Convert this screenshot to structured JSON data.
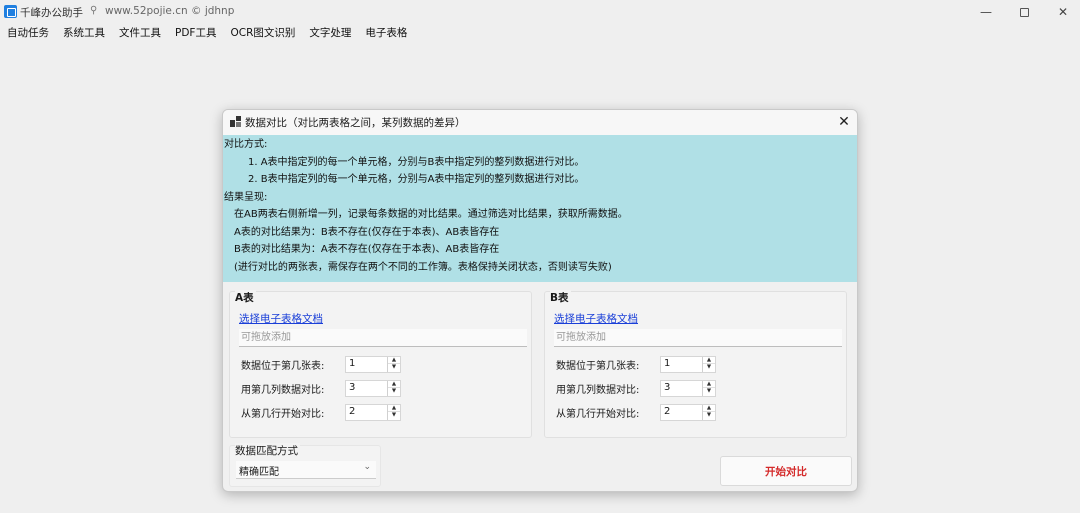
{
  "app": {
    "title": "千峰办公助手",
    "subtitle": "www.52pojie.cn © jdhnp",
    "window_controls": {
      "minimize": "—",
      "close": "✕"
    }
  },
  "menu": [
    "自动任务",
    "系统工具",
    "文件工具",
    "PDF工具",
    "OCR图文识别",
    "文字处理",
    "电子表格"
  ],
  "dialog": {
    "title": "数据对比（对比两表格之间，某列数据的差异）",
    "close": "✕",
    "info_lines": [
      "对比方式:",
      "1. A表中指定列的每一个单元格，分别与B表中指定列的整列数据进行对比。",
      "2. B表中指定列的每一个单元格，分别与A表中指定列的整列数据进行对比。",
      "结果呈现:",
      "在AB两表右侧新增一列，记录每条数据的对比结果。通过筛选对比结果，获取所需数据。",
      "A表的对比结果为：B表不存在(仅存在于本表)、AB表皆存在",
      "B表的对比结果为：A表不存在(仅存在于本表)、AB表皆存在",
      "(进行对比的两张表，需保存在两个不同的工作簿。表格保持关闭状态，否则读写失败)"
    ],
    "panel_a": {
      "title": "A表",
      "link": "选择电子表格文档",
      "placeholder": "可拖放添加",
      "sheet_label": "数据位于第几张表:",
      "sheet_value": "1",
      "col_label": "用第几列数据对比:",
      "col_value": "3",
      "row_label": "从第几行开始对比:",
      "row_value": "2"
    },
    "panel_b": {
      "title": "B表",
      "link": "选择电子表格文档",
      "placeholder": "可拖放添加",
      "sheet_label": "数据位于第几张表:",
      "sheet_value": "1",
      "col_label": "用第几列数据对比:",
      "col_value": "3",
      "row_label": "从第几行开始对比:",
      "row_value": "2"
    },
    "match": {
      "title": "数据匹配方式",
      "selected": "精确匹配"
    },
    "start_button": "开始对比"
  },
  "colors": {
    "info_bg": "#b0e0e6",
    "link": "#1a3fd8",
    "start_text": "#d42a2a",
    "app_icon": "#1f7fe0"
  }
}
